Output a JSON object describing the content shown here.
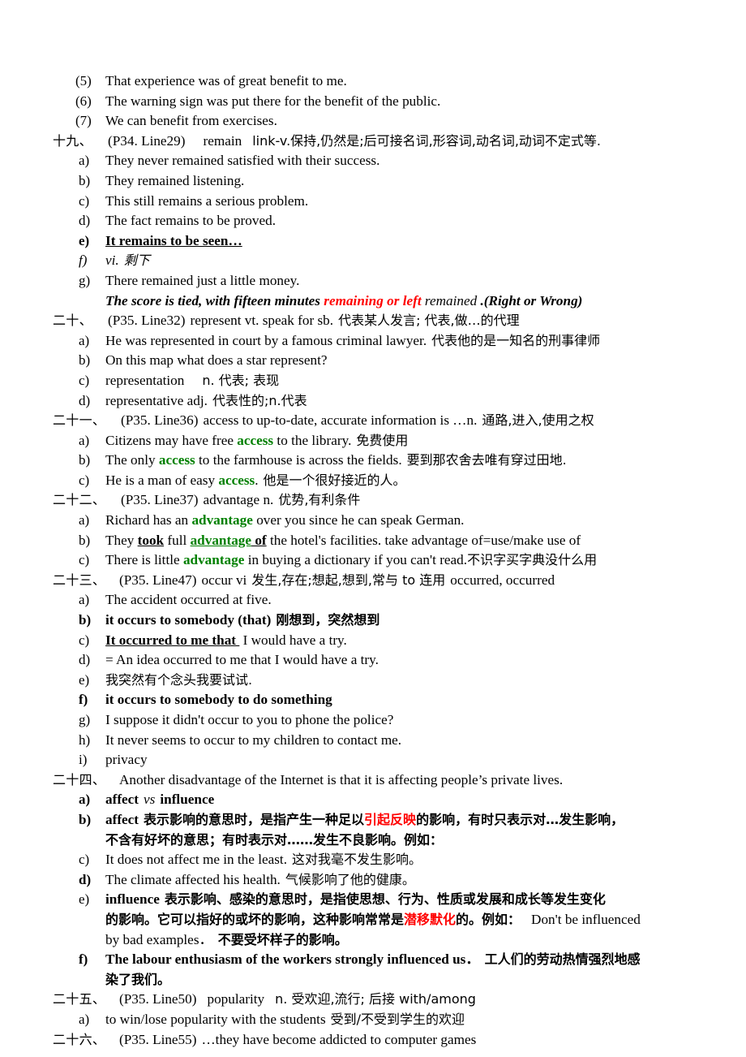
{
  "document": {
    "title": "English vocabulary study notes - Unit entries 19 to 26",
    "colors": {
      "text": "#000000",
      "highlight_green": "#008000",
      "highlight_red": "#ff0000",
      "page_background": "#ffffff"
    }
  },
  "benefit_examples": {
    "items": [
      {
        "marker": "(5)",
        "text": "That experience was of great benefit to me."
      },
      {
        "marker": "(6)",
        "text": "The warning sign was put there for the benefit of the public."
      },
      {
        "marker": "(7)",
        "text": "We can benefit from exercises."
      }
    ]
  },
  "entries": [
    {
      "number": "十九、",
      "heading": {
        "ref": "(P34. Line29)",
        "word": "remain",
        "gloss": "link-v.保持,仍然是;后可接名词,形容词,动名词,动词不定式等."
      },
      "items": [
        {
          "marker": "a)",
          "text": "They never remained satisfied with their success."
        },
        {
          "marker": "b)",
          "text": "They remained listening."
        },
        {
          "marker": "c)",
          "text": "This still remains a serious problem."
        },
        {
          "marker": "d)",
          "text": "The fact remains to be proved."
        },
        {
          "marker": "e)",
          "text": "It remains to be seen…",
          "style": "bold-underline"
        },
        {
          "marker": "f)",
          "text_a": "vi.",
          "text_b": "剩下",
          "style": "italic"
        },
        {
          "marker": "g)",
          "text": "There remained just a little money."
        }
      ],
      "note": {
        "before": "The score is tied, with fifteen minutes ",
        "red": "remaining or left",
        "middle": " remained ",
        "after": ".(Right or Wrong)"
      }
    },
    {
      "number": "二十、",
      "heading": {
        "ref": "(P35. Line32)",
        "word": "represent vt. speak for sb.",
        "gloss": "代表某人发言; 代表,做…的代理"
      },
      "items": [
        {
          "marker": "a)",
          "text": "He was represented in court by a famous criminal lawyer.",
          "cn": "代表他的是一知名的刑事律师"
        },
        {
          "marker": "b)",
          "text": "On this map what does a star represent?"
        },
        {
          "marker": "c)",
          "text": "representation",
          "cn": "n. 代表; 表现"
        },
        {
          "marker": "d)",
          "text": "representative adj.",
          "cn": "代表性的;n.代表"
        }
      ]
    },
    {
      "number": "二十一、",
      "heading": {
        "ref": "(P35. Line36)",
        "word": "access to up-to-date, accurate information is …n.",
        "gloss": "通路,进入,使用之权"
      },
      "items": [
        {
          "marker": "a)",
          "pre": "Citizens may have free ",
          "kw": "access",
          "post": " to the library.",
          "cn": "免费使用"
        },
        {
          "marker": "b)",
          "pre": "The only ",
          "kw": "access",
          "post": " to the farmhouse is across the fields.",
          "cn": "要到那农舍去唯有穿过田地."
        },
        {
          "marker": "c)",
          "pre": "He is a man of easy ",
          "kw": "access",
          "post": ".",
          "cn": "他是一个很好接近的人。"
        }
      ]
    },
    {
      "number": "二十二、",
      "heading": {
        "ref": "(P35. Line37)",
        "word": "advantage n.",
        "gloss": "优势,有利条件"
      },
      "items": [
        {
          "marker": "a)",
          "pre": "Richard has an ",
          "kw": "advantage",
          "post": " over you since he can speak German."
        },
        {
          "marker": "b)",
          "pre": "They ",
          "bu1": "took",
          "mid": " full ",
          "kw_u": "advantage",
          "bu2": " of",
          "post": " the hotel's facilities. take advantage of=use/make use of"
        },
        {
          "marker": "c)",
          "pre": "There is little ",
          "kw": "advantage",
          "post": " in buying a dictionary if you can't read.",
          "cn": "不识字买字典没什么用"
        }
      ]
    },
    {
      "number": "二十三、",
      "heading": {
        "ref": "(P35. Line47)",
        "word": "occur vi",
        "gloss": "发生,存在;想起,想到,常与 to 连用",
        "tail": "occurred, occurred"
      },
      "items": [
        {
          "marker": "a)",
          "text": "The accident occurred at five."
        },
        {
          "marker": "b)",
          "text": "it occurs to somebody (that)",
          "cn": "刚想到，突然想到",
          "style": "bold"
        },
        {
          "marker": "c)",
          "bu": "It occurred to me that",
          "post": " I would have a try."
        },
        {
          "marker": "d)",
          "text": "= An idea occurred to me that I would have a try."
        },
        {
          "marker": "e)",
          "cn_only": "我突然有个念头我要试试."
        },
        {
          "marker": "f)",
          "text": "it occurs to somebody to do something",
          "style": "bold"
        },
        {
          "marker": "g)",
          "text": "I suppose it didn't occur to you to phone the police?"
        },
        {
          "marker": "h)",
          "text": "It never seems to occur to my children to contact me."
        },
        {
          "marker": "i)",
          "text": "privacy"
        }
      ]
    },
    {
      "number": "二十四、",
      "heading": {
        "sentence": "Another disadvantage of the Internet is that it is affecting people’s private lives."
      },
      "items": [
        {
          "marker": "a)",
          "bold_a": "affect",
          "italic_vs": "vs",
          "bold_b": "influence"
        },
        {
          "marker": "b)",
          "kw": "affect",
          "cn_line1_a": "表示影响的意思时，是指产生一种足以",
          "cn_red": "引起反映",
          "cn_line1_b": "的影响，有时只表示对…发生影响，",
          "cn_line2": "不含有好坏的意思；有时表示对……发生不良影响。例如："
        },
        {
          "marker": "c)",
          "text": "It does not affect me in the least.",
          "cn": "这对我毫不发生影响。"
        },
        {
          "marker": "d)",
          "text": "The climate affected his health.",
          "cn": "气候影响了他的健康。",
          "style": "bold-marker"
        },
        {
          "marker": "e)",
          "kw": "influence",
          "cn_line1": "表示影响、感染的意思时，是指使思想、行为、性质或发展和成长等发生变化",
          "cn_line2_a": "的影响。它可以指好的或坏的影响，这种影响常常是",
          "cn_red": "潜移默化",
          "cn_line2_b": "的。例如：",
          "en_line2": "Don't be influenced",
          "en_line3": "by bad examples．",
          "cn_line3": "不要受坏样子的影响。"
        },
        {
          "marker": "f)",
          "text": "The labour enthusiasm of the workers strongly influenced us．",
          "cn": "工人们的劳动热情强烈地感",
          "cn_cont": "染了我们。",
          "style": "bold"
        }
      ]
    },
    {
      "number": "二十五、",
      "heading": {
        "ref": "(P35. Line50)",
        "word": "popularity",
        "gloss": "n. 受欢迎,流行; 后接 with/among"
      },
      "items": [
        {
          "marker": "a)",
          "text": "to win/lose popularity with the students",
          "cn": "受到/不受到学生的欢迎"
        }
      ]
    },
    {
      "number": "二十六、",
      "heading": {
        "ref": "(P35. Line55)",
        "word": "…they have become addicted to computer games"
      },
      "items": []
    }
  ]
}
